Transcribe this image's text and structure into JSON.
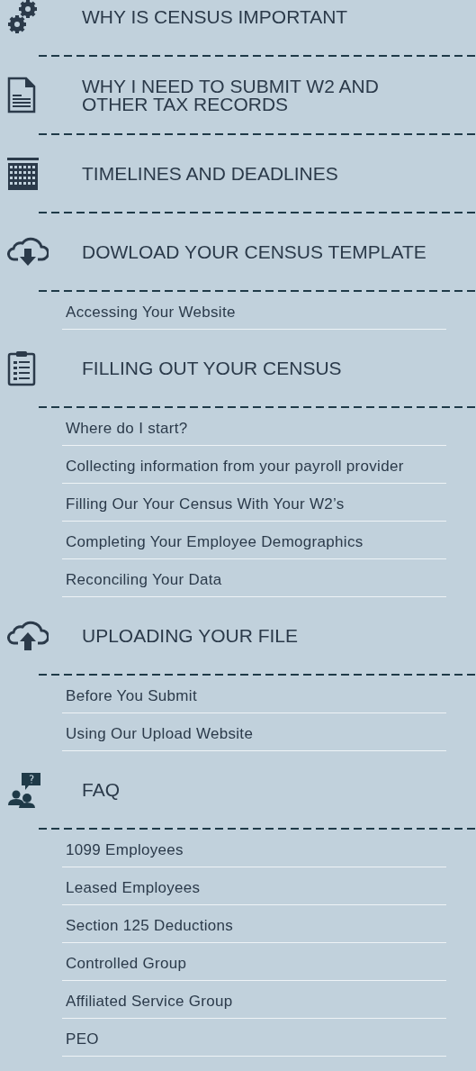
{
  "sections": [
    {
      "title": "WHY IS CENSUS IMPORTANT"
    },
    {
      "title": "WHY I NEED TO SUBMIT W2 AND OTHER TAX RECORDS"
    },
    {
      "title": "TIMELINES AND DEADLINES"
    },
    {
      "title": "DOWLOAD YOUR CENSUS TEMPLATE",
      "items": [
        "Accessing Your Website"
      ]
    },
    {
      "title": "FILLING OUT YOUR CENSUS",
      "items": [
        "Where do I start?",
        "Collecting information from your payroll provider",
        "Filling Our Your Census With Your W2’s",
        "Completing Your Employee Demographics",
        "Reconciling Your Data"
      ]
    },
    {
      "title": "UPLOADING YOUR FILE",
      "items": [
        "Before You Submit",
        "Using Our Upload Website"
      ]
    },
    {
      "title": "FAQ",
      "items": [
        "1099 Employees",
        "Leased Employees",
        "Section 125 Deductions",
        "Controlled Group",
        "Affiliated Service Group",
        "PEO"
      ]
    }
  ]
}
